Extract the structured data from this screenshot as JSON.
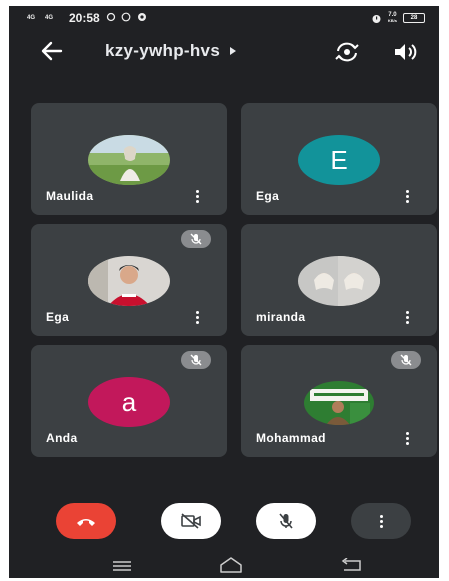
{
  "status": {
    "network_left": "4G",
    "network_right": "4G",
    "time": "20:58",
    "speed": "7.0",
    "speed_unit": "KB/s",
    "battery": "28"
  },
  "header": {
    "meeting_code": "kzy-ywhp-hvs"
  },
  "participants": [
    {
      "name": "Maulida",
      "avatar_type": "photo",
      "muted": false
    },
    {
      "name": "Ega",
      "avatar_type": "letter",
      "letter": "E",
      "color": "#12939a",
      "muted": false
    },
    {
      "name": "Ega",
      "avatar_type": "photo",
      "muted": true
    },
    {
      "name": "miranda",
      "avatar_type": "photo",
      "muted": false
    },
    {
      "name": "Anda",
      "avatar_type": "letter",
      "letter": "a",
      "color": "#c2185b",
      "muted": true
    },
    {
      "name": "Mohammad",
      "avatar_type": "photo",
      "muted": true
    }
  ],
  "colors": {
    "background": "#202124",
    "tile": "#3c4043",
    "end_call": "#ea4335",
    "muted_badge": "#8a8c8f"
  },
  "icons": {
    "back": "arrow-left-icon",
    "info": "caret-right-icon",
    "flip_camera": "flip-camera-icon",
    "speaker": "speaker-icon",
    "end_call": "phone-hangup-icon",
    "camera_off": "camera-off-icon",
    "mic_off": "mic-off-icon",
    "more": "more-vertical-icon"
  }
}
